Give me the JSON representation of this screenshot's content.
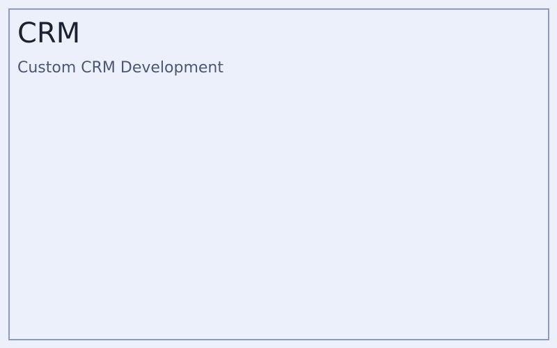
{
  "card": {
    "title": "CRM",
    "subtitle": "Custom CRM Development"
  },
  "colors": {
    "background": "#ecf0fb",
    "border": "#8e9cbc",
    "title_text": "#1a2230",
    "subtitle_text": "#4b5872"
  }
}
